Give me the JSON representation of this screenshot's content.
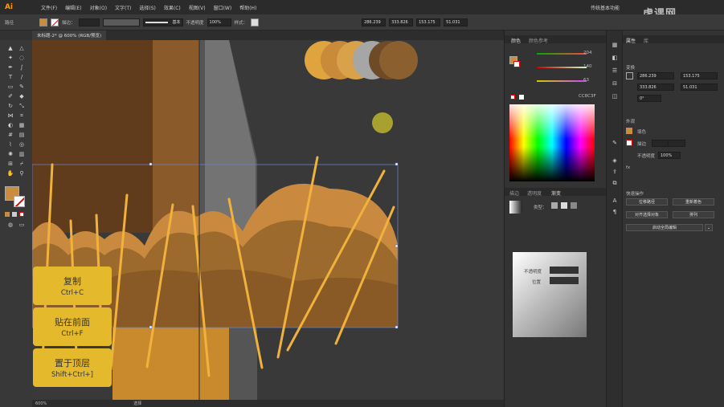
{
  "app": {
    "logo": "Ai",
    "menu": [
      "文件(F)",
      "编辑(E)",
      "对象(O)",
      "文字(T)",
      "选择(S)",
      "效果(C)",
      "视图(V)",
      "窗口(W)",
      "帮助(H)"
    ],
    "workspace": "传统基本功能",
    "watermark": "虎课网"
  },
  "control_bar": {
    "path_label": "路径",
    "stroke_label": "描边：",
    "brush_label": "基本",
    "opacity_label": "不透明度",
    "opacity_value": "100%",
    "style_label": "样式：",
    "x_value": "286.239",
    "y_value": "333.826",
    "w_value": "153.175",
    "h_value": "51.031"
  },
  "document": {
    "tab_title": "未标题-2* @ 600% (RGB/预览)",
    "zoom": "600%",
    "status_tool": "选择"
  },
  "shortcuts": [
    {
      "title": "复制",
      "keys": "Ctrl+C"
    },
    {
      "title": "贴在前面",
      "keys": "Ctrl+F"
    },
    {
      "title": "置于顶层",
      "keys": "Shift+Ctrl+]"
    }
  ],
  "color_panel": {
    "tabs": [
      "颜色",
      "颜色参考"
    ],
    "r_value": "204",
    "g_value": "140",
    "b_value": "63",
    "hex_value": "CC8C3F"
  },
  "gradient_panel": {
    "tabs": [
      "描边",
      "透明度",
      "渐变"
    ],
    "type_label": "类型：",
    "opacity_label": "不透明度",
    "location_label": "位置"
  },
  "properties": {
    "tabs": [
      "属性",
      "库"
    ],
    "section_transform": "变换",
    "x": "286.239",
    "y": "333.826",
    "w": "153.175",
    "h": "51.031",
    "angle": "0°",
    "section_appearance": "外观",
    "fill_label": "填色",
    "stroke_label": "描边",
    "opacity_label": "不透明度",
    "opacity_value": "100%",
    "fx_label": "fx",
    "section_quick": "快速操作",
    "btn_offset": "位移路径",
    "btn_recolor": "重新着色",
    "btn_align": "对齐选择对象",
    "btn_arrange": "排列",
    "btn_global": "启动全局编辑"
  },
  "colors": {
    "accent_fill": "#cc8c3f",
    "shortcut_bg": "#e4b92c"
  }
}
